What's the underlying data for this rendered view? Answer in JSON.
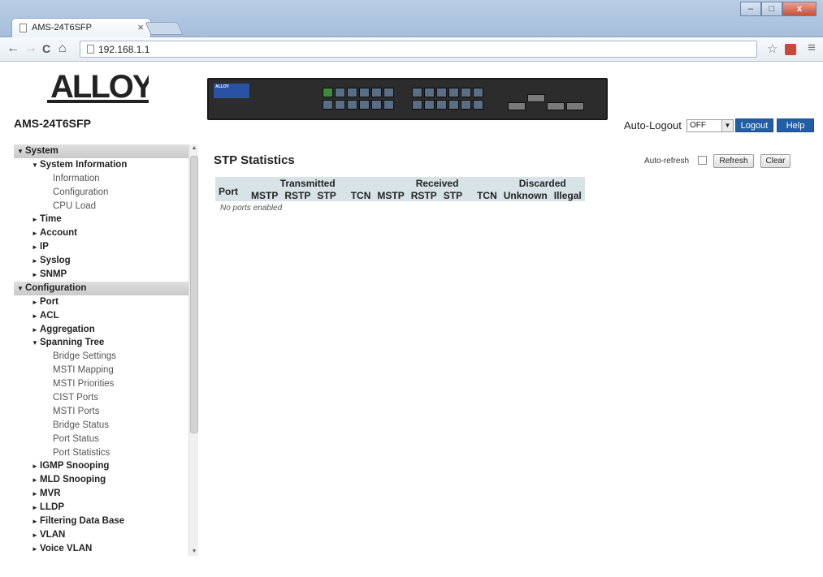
{
  "browser": {
    "tab_title": "AMS-24T6SFP",
    "tab_close": "×",
    "url": "192.168.1.1",
    "nav_back": "←",
    "nav_forward": "→",
    "nav_reload": "C",
    "nav_home": "⌂",
    "star": "☆",
    "menu": "≡",
    "win_min": "–",
    "win_max": "□",
    "win_close": "x"
  },
  "header": {
    "logo_text": "ALLOY",
    "model": "AMS-24T6SFP",
    "switch_brand": "ALLOY",
    "auto_logout_label": "Auto-Logout",
    "auto_logout_value": "OFF",
    "logout_button": "Logout",
    "help_button": "Help"
  },
  "sidebar": {
    "items": [
      {
        "label": "System",
        "level": "section",
        "marker": "▼"
      },
      {
        "label": "System Information",
        "level": "l1",
        "marker": "▼"
      },
      {
        "label": "Information",
        "level": "l2"
      },
      {
        "label": "Configuration",
        "level": "l2"
      },
      {
        "label": "CPU Load",
        "level": "l2"
      },
      {
        "label": "Time",
        "level": "l1",
        "marker": "►"
      },
      {
        "label": "Account",
        "level": "l1",
        "marker": "►"
      },
      {
        "label": "IP",
        "level": "l1",
        "marker": "►"
      },
      {
        "label": "Syslog",
        "level": "l1",
        "marker": "►"
      },
      {
        "label": "SNMP",
        "level": "l1",
        "marker": "►"
      },
      {
        "label": "Configuration",
        "level": "section",
        "marker": "▼"
      },
      {
        "label": "Port",
        "level": "l1",
        "marker": "►"
      },
      {
        "label": "ACL",
        "level": "l1",
        "marker": "►"
      },
      {
        "label": "Aggregation",
        "level": "l1",
        "marker": "►"
      },
      {
        "label": "Spanning Tree",
        "level": "l1",
        "marker": "▼"
      },
      {
        "label": "Bridge Settings",
        "level": "l2"
      },
      {
        "label": "MSTI Mapping",
        "level": "l2"
      },
      {
        "label": "MSTI Priorities",
        "level": "l2"
      },
      {
        "label": "CIST Ports",
        "level": "l2"
      },
      {
        "label": "MSTI Ports",
        "level": "l2"
      },
      {
        "label": "Bridge Status",
        "level": "l2"
      },
      {
        "label": "Port Status",
        "level": "l2"
      },
      {
        "label": "Port Statistics",
        "level": "l2"
      },
      {
        "label": "IGMP Snooping",
        "level": "l1",
        "marker": "►"
      },
      {
        "label": "MLD Snooping",
        "level": "l1",
        "marker": "►"
      },
      {
        "label": "MVR",
        "level": "l1",
        "marker": "►"
      },
      {
        "label": "LLDP",
        "level": "l1",
        "marker": "►"
      },
      {
        "label": "Filtering Data Base",
        "level": "l1",
        "marker": "►"
      },
      {
        "label": "VLAN",
        "level": "l1",
        "marker": "►"
      },
      {
        "label": "Voice VLAN",
        "level": "l1",
        "marker": "►"
      }
    ]
  },
  "main": {
    "title": "STP Statistics",
    "auto_refresh_label": "Auto-refresh",
    "refresh_button": "Refresh",
    "clear_button": "Clear",
    "table": {
      "port_header": "Port",
      "groups": [
        "Transmitted",
        "Received",
        "Discarded"
      ],
      "transmitted_cols": [
        "MSTP",
        "RSTP",
        "STP",
        "TCN"
      ],
      "received_cols": [
        "MSTP",
        "RSTP",
        "STP",
        "TCN"
      ],
      "discarded_cols": [
        "Unknown",
        "Illegal"
      ],
      "empty_message": "No ports enabled"
    }
  },
  "colors": {
    "header_button": "#215ea6",
    "table_header": "#d7e3e7",
    "sidebar_section": "#c9c9c9"
  }
}
